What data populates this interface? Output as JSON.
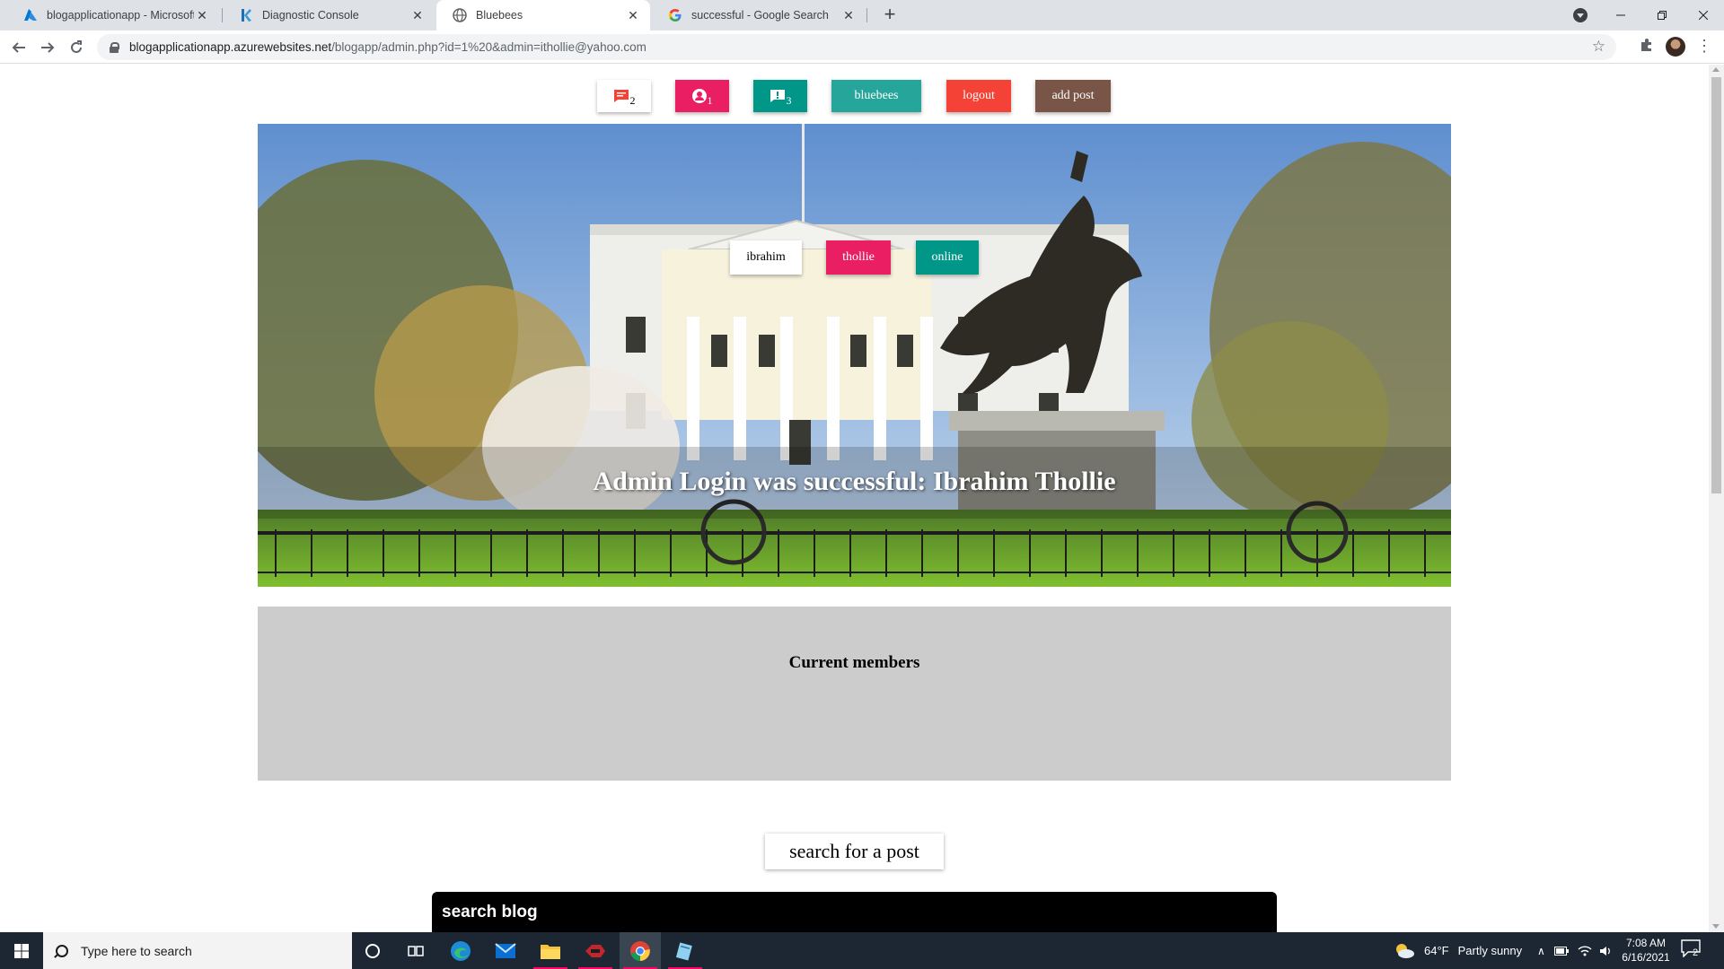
{
  "browser": {
    "tabs": [
      {
        "title": "blogapplicationapp - Microsoft A",
        "close": "✕",
        "active": false
      },
      {
        "title": "Diagnostic Console",
        "close": "✕",
        "active": false
      },
      {
        "title": "Bluebees",
        "close": "✕",
        "active": true
      },
      {
        "title": "successful - Google Search",
        "close": "✕",
        "active": false
      }
    ],
    "new_tab": "+",
    "url_domain": "blogapplicationapp.azurewebsites.net",
    "url_path": "/blogapp/admin.php?id=1%20&admin=ithollie@yahoo.com"
  },
  "topnav": {
    "messages_count": "2",
    "users_count": "1",
    "comments_count": "3",
    "bluebees": "bluebees",
    "logout": "logout",
    "add_post": "add post"
  },
  "hero": {
    "badge_first": "ibrahim",
    "badge_last": "thollie",
    "badge_status": "online",
    "message": "Admin Login was successful: Ibrahim Thollie"
  },
  "members": {
    "title": "Current members"
  },
  "search": {
    "button": "search for a post",
    "bar_label": "search blog"
  },
  "taskbar": {
    "search_placeholder": "Type here to search",
    "weather_temp": "64°F",
    "weather_desc": "Partly sunny",
    "time": "7:08 AM",
    "date": "6/16/2021",
    "notifications": "2"
  },
  "colors": {
    "pink": "#e91e63",
    "teal_dark": "#009688",
    "teal": "#26a69a",
    "red": "#f44336",
    "brown": "#795548",
    "members_bg": "#cccccc"
  }
}
